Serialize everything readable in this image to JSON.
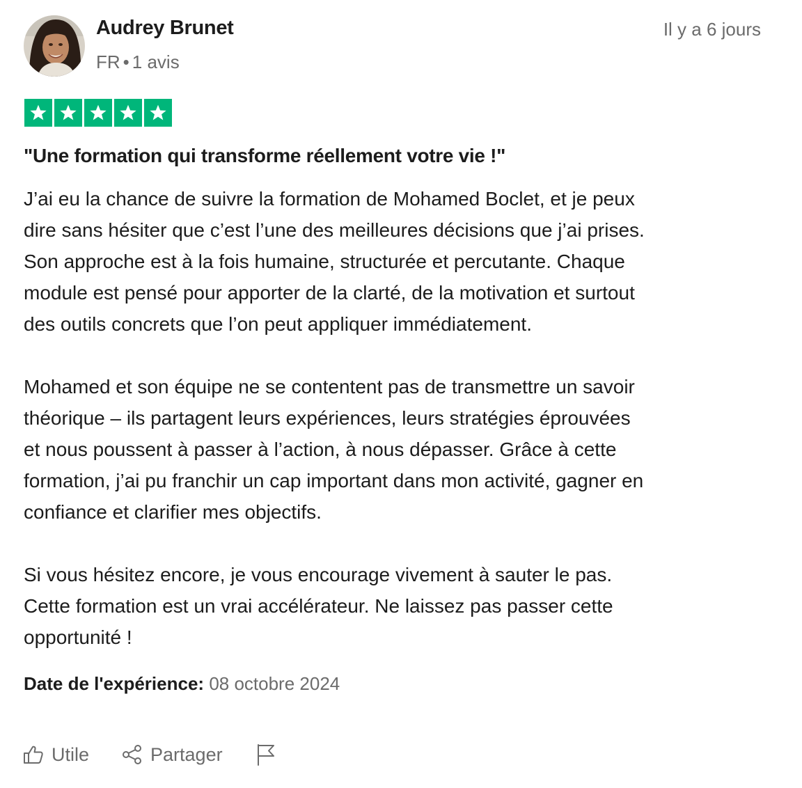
{
  "reviewer": {
    "name": "Audrey Brunet",
    "country": "FR",
    "separator": "•",
    "reviews_count": "1 avis",
    "avatar_icon": "user-photo"
  },
  "review": {
    "relative_date": "Il y a 6 jours",
    "rating": 5,
    "rating_max": 5,
    "star_color": "#00b67a",
    "title": "\"Une formation qui transforme réellement votre vie !\"",
    "paragraphs": [
      "J’ai eu la chance de suivre la formation de Mohamed Boclet, et je peux\ndire sans hésiter que c’est l’une des meilleures décisions que j’ai prises.\nSon approche est à la fois humaine, structurée et percutante. Chaque\nmodule est pensé pour apporter de la clarté, de la motivation et surtout\ndes outils concrets que l’on peut appliquer immédiatement.",
      "Mohamed et son équipe ne se contentent pas de transmettre un savoir\nthéorique – ils partagent leurs expériences, leurs stratégies éprouvées\net nous poussent à passer à l’action, à nous dépasser. Grâce à cette\nformation, j’ai pu franchir un cap important dans mon activité, gagner en\nconfiance et clarifier mes objectifs.",
      "Si vous hésitez encore, je vous encourage vivement à sauter le pas.\nCette formation est un vrai accélérateur. Ne laissez pas passer cette\nopportunité !"
    ],
    "experience_label": "Date de l'expérience:",
    "experience_date": "08 octobre 2024"
  },
  "actions": {
    "useful_label": "Utile",
    "useful_icon": "thumbs-up-icon",
    "share_label": "Partager",
    "share_icon": "share-icon",
    "report_icon": "flag-icon"
  }
}
